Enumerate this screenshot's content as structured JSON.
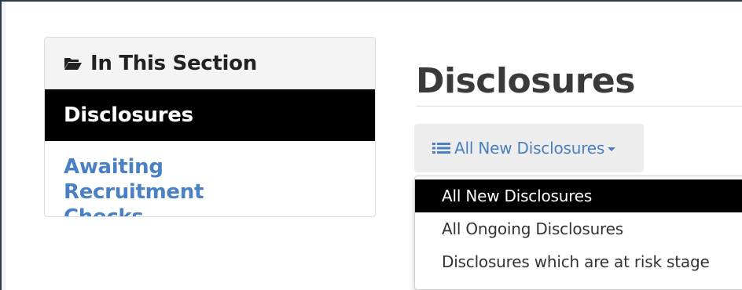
{
  "sidebar": {
    "header_icon": "folder-open-icon",
    "title": "In This Section",
    "items": [
      {
        "label": "Disclosures",
        "active": true
      },
      {
        "label": "Awaiting Recruitment Checks",
        "active": false
      }
    ]
  },
  "main": {
    "page_title": "Disclosures",
    "dropdown": {
      "icon": "list-icon",
      "selected_label": "All New Disclosures",
      "options": [
        {
          "label": "All New Disclosures",
          "active": true
        },
        {
          "label": "All Ongoing Disclosures",
          "active": false
        },
        {
          "label": "Disclosures which are at risk stage",
          "active": false
        }
      ]
    }
  },
  "colors": {
    "link": "#4a80c4",
    "active_bg": "#000000",
    "panel_header_bg": "#f4f4f4",
    "toggle_bg": "#ededed"
  }
}
